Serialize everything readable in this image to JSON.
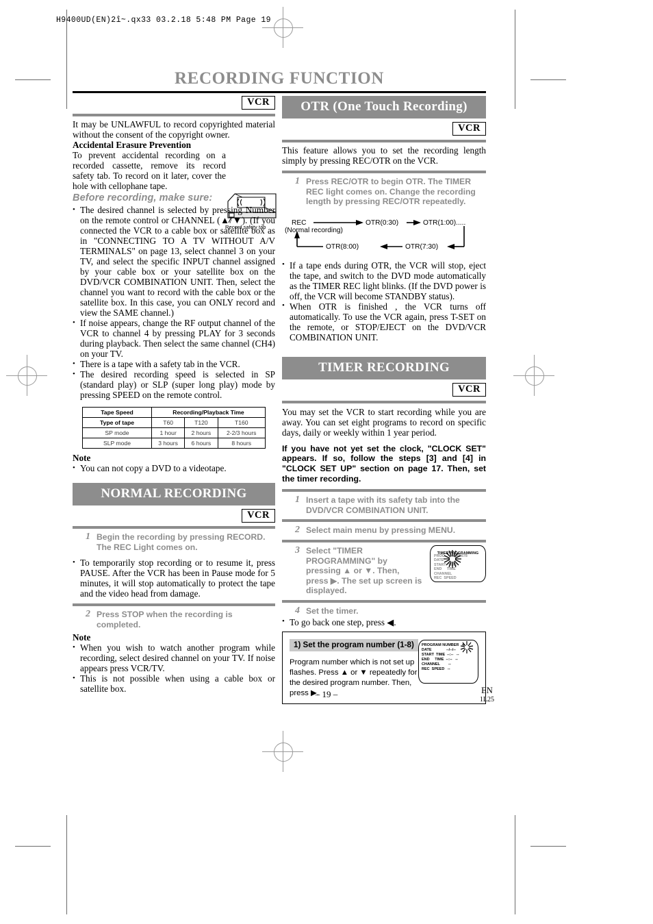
{
  "slug": "H9400UD(EN)2î~.qx33    03.2.18 5:48 PM    Page 19",
  "masthead": "RECORDING FUNCTION",
  "badges": {
    "vcr": "VCR"
  },
  "left": {
    "intro": "It may be UNLAWFUL to record copyrighted material without the consent of the copyright owner.",
    "erasure_heading": "Accidental Erasure Prevention",
    "erasure_text": "To prevent accidental recording on a recorded cassette, remove its record safety tab. To record on it later, cover the hole with cellophane tape.",
    "cassette_caption": "Record safety tab",
    "before_heading": "Before recording, make sure:",
    "bullets": [
      "The desired channel is selected by pressing Number on the remote control or CHANNEL (▲/▼). (If you connected the VCR to a cable box or satellite box as in \"CONNECTING TO A TV WITHOUT A/V TERMINALS\" on page 13, select channel 3 on your TV, and select the specific INPUT channel assigned by your cable box or your  satellite box on the DVD/VCR COMBINATION UNIT. Then, select the channel you want to record with the cable box or the satellite box. In this case, you can ONLY record and view the SAME channel.)",
      "If noise appears, change the RF output channel of the VCR to channel 4 by pressing PLAY for 3 seconds during playback.  Then select the same channel (CH4) on your TV.",
      "There is a tape with a safety tab in the VCR.",
      "The desired recording speed is selected in SP (standard play) or SLP (super long play) mode by pressing SPEED on the remote control."
    ],
    "table": {
      "header_row": [
        "Tape Speed",
        "Recording/Playback Time"
      ],
      "sub_row": [
        "Type of tape",
        "T60",
        "T120",
        "T160"
      ],
      "rows": [
        [
          "SP mode",
          "1 hour",
          "2 hours",
          "2-2/3 hours"
        ],
        [
          "SLP mode",
          "3 hours",
          "6 hours",
          "8 hours"
        ]
      ]
    },
    "note_heading": "Note",
    "note_bullet": "You can not copy a DVD to a videotape.",
    "normal_recording": {
      "title": "NORMAL RECORDING",
      "step1_num": "1",
      "step1_text": "Begin the recording by pressing RECORD. The REC Light comes on.",
      "bullet1": "To temporarily stop recording or to resume it, press PAUSE. After the VCR has been in Pause mode for 5 minutes, it will stop automatically to protect the tape and the video head from damage.",
      "step2_num": "2",
      "step2_text": "Press STOP when the recording is completed.",
      "note_heading": "Note",
      "notes": [
        "When you wish to watch another program while recording, select desired channel on your TV.  If noise appears press VCR/TV.",
        "This is not possible when using a cable box or satellite box."
      ]
    }
  },
  "right": {
    "otr": {
      "title": "OTR (One Touch Recording)",
      "intro": "This feature allows you to set the recording length simply by pressing REC/OTR on the VCR.",
      "step1_num": "1",
      "step1_text": "Press REC/OTR to begin OTR. The TIMER REC light comes on. Change the recording length by pressing REC/OTR repeatedly.",
      "flow": {
        "rec": "REC",
        "rec_sub": "(Normal recording)",
        "n1": "OTR(0:30)",
        "n2": "OTR(1:00).....",
        "n3": "OTR(7:30)",
        "n4": "OTR(8:00)"
      },
      "bullets": [
        "If a tape ends during OTR, the VCR will stop, eject the tape, and switch to the DVD mode automatically as the TIMER REC light blinks. (If the DVD power is off, the VCR will become STANDBY status).",
        "When OTR is finished , the VCR turns off automatically. To use the VCR again, press T-SET on the remote, or STOP/EJECT on the DVD/VCR COMBINATION UNIT."
      ]
    },
    "timer": {
      "title": "TIMER RECORDING",
      "intro": "You may set the VCR to start recording while you are away. You can set eight programs to record on specific days, daily or weekly within 1 year period.",
      "clock_note": "If you have not yet set the clock, \"CLOCK SET\" appears. If so, follow the steps [3] and [4] in \"CLOCK SET UP\" section on page 17. Then, set the timer recording.",
      "step1_num": "1",
      "step1_text": "Insert a tape with its safety tab into the DVD/VCR COMBINATION UNIT.",
      "step2_num": "2",
      "step2_text": "Select main menu by pressing MENU.",
      "step3_num": "3",
      "step3_text": "Select \"TIMER PROGRAMMING\" by pressing ▲ or ▼. Then, press ▶. The set up screen is displayed.",
      "step4_num": "4",
      "step4_text": "Set the timer.",
      "back_bullet": "To go back one step, press ◀.",
      "screen1": {
        "title": "TIMER PROGRAMMING",
        "lines": "PROG      12345678\nDATE\nSTART  TIME\nEND     TIME\nCHANNEL\nREC  SPEED"
      },
      "boxed": {
        "tag": "1) Set the program number (1-8)",
        "text": "Program number which is not set up flashes. Press ▲ or ▼ repeatedly for the desired program number. Then, press ▶.",
        "screen2_lines": "PROGRAM NUMBER   4\nDATE              --/--/--\nSTART  TIME  --:--   --\nEND     TIME  --:--   --\nCHANNEL        --\nREC  SPEED   --"
      }
    }
  },
  "footer": {
    "page": "– 19 –",
    "lang": "EN",
    "code": "1L25"
  }
}
